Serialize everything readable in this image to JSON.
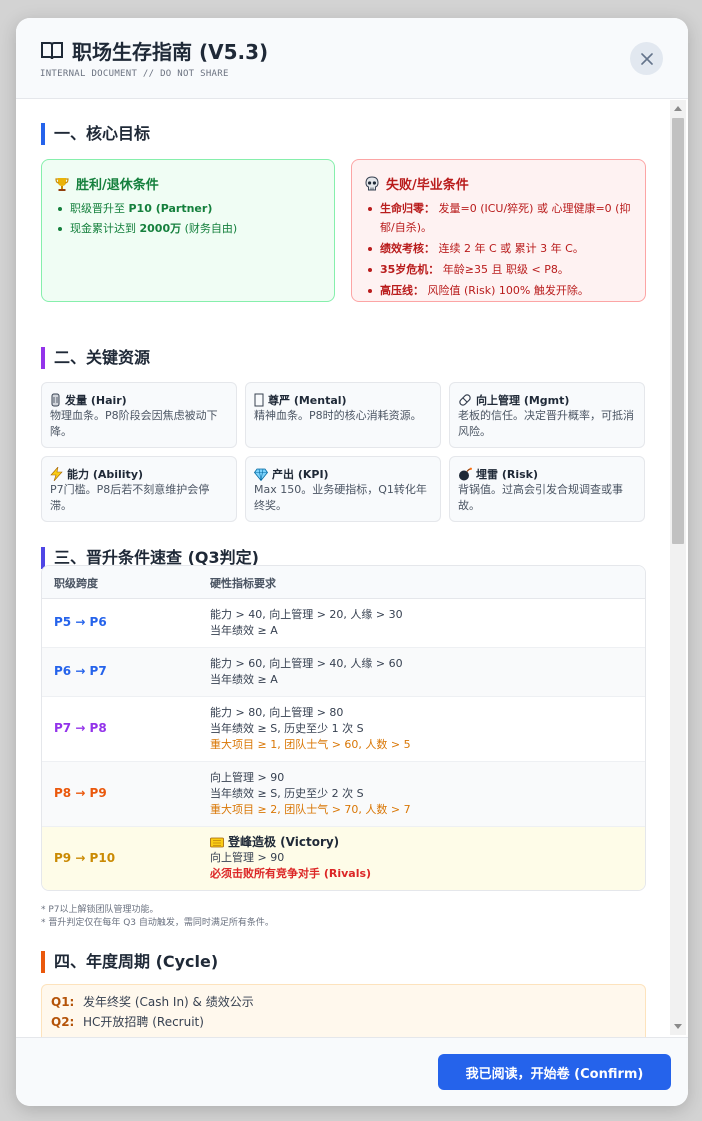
{
  "header": {
    "title": "职场生存指南 (V5.3)",
    "subtitle": "INTERNAL DOCUMENT // DO NOT SHARE",
    "close_icon": "close-icon"
  },
  "sections": {
    "goals": {
      "title": "一、核心目标",
      "accent": "#2563eb",
      "win": {
        "title": "胜利/退休条件",
        "icon": "trophy-icon",
        "items": [
          {
            "prefix": "职级晋升至 ",
            "bold": "P10 (Partner)",
            "suffix": ""
          },
          {
            "prefix": "现金累计达到 ",
            "bold": "2000万",
            "suffix": " (财务自由)"
          }
        ]
      },
      "lose": {
        "title": "失败/毕业条件",
        "icon": "skull-icon",
        "items": [
          {
            "label": "生命归零：",
            "text": " 发量=0 (ICU/猝死) 或 心理健康=0 (抑郁/自杀)。"
          },
          {
            "label": "绩效考核：",
            "text": " 连续 2 年 C 或 累计 3 年 C。"
          },
          {
            "label": "35岁危机：",
            "text": " 年龄≥35 且 职级 < P8。"
          },
          {
            "label": "高压线：",
            "text": " 风险值 (Risk) 100% 触发开除。"
          }
        ]
      }
    },
    "resources": {
      "title": "二、关键资源",
      "accent": "#9333ea",
      "items": [
        {
          "name": "发量 (Hair)",
          "icon": "hair-icon",
          "desc": "物理血条。P8阶段会因焦虑被动下降。"
        },
        {
          "name": "尊严 (Mental)",
          "icon": "mental-icon",
          "desc": "精神血条。P8时的核心消耗资源。"
        },
        {
          "name": "向上管理 (Mgmt)",
          "icon": "pill-icon",
          "desc": "老板的信任。决定晋升概率，可抵消风险。"
        },
        {
          "name": "能力 (Ability)",
          "icon": "lightning-icon",
          "desc": "P7门槛。P8后若不刻意维护会停滞。"
        },
        {
          "name": "产出 (KPI)",
          "icon": "diamond-icon",
          "desc": "Max 150。业务硬指标，Q1转化年终奖。"
        },
        {
          "name": "埋雷 (Risk)",
          "icon": "bomb-icon",
          "desc": "背锅值。过高会引发合规调查或事故。"
        }
      ]
    },
    "promotion": {
      "title": "三、晋升条件速查 (Q3判定)",
      "accent": "#4f46e5",
      "headers": [
        "职级跨度",
        "硬性指标要求"
      ],
      "rows": [
        {
          "level": "P5 → P6",
          "color": "#2563eb",
          "lines": [
            "能力 > 40, 向上管理 > 20, 人缘 > 30",
            "当年绩效 ≥ A"
          ],
          "gold": "",
          "victory": "",
          "red": ""
        },
        {
          "level": "P6 → P7",
          "color": "#2563eb",
          "lines": [
            "能力 > 60, 向上管理 > 40, 人缘 > 60",
            "当年绩效 ≥ A"
          ],
          "gold": "",
          "victory": "",
          "red": ""
        },
        {
          "level": "P7 → P8",
          "color": "#9333ea",
          "lines": [
            "能力 > 80, 向上管理 > 80",
            "当年绩效 ≥ S, 历史至少 1 次 S"
          ],
          "gold": "重大项目 ≥ 1, 团队士气 > 60, 人数 > 5",
          "victory": "",
          "red": ""
        },
        {
          "level": "P8 → P9",
          "color": "#ea580c",
          "lines": [
            "向上管理 > 90",
            "当年绩效 ≥ S, 历史至少 2 次 S"
          ],
          "gold": "重大项目 ≥ 2, 团队士气 > 70, 人数 > 7",
          "victory": "",
          "red": ""
        },
        {
          "level": "P9 → P10",
          "color": "#ca8a04",
          "lines": [
            "向上管理 > 90"
          ],
          "gold": "",
          "victory": "登峰造极 (Victory)",
          "red": "必须击败所有竞争对手 (Rivals)"
        }
      ],
      "notes": [
        "* P7以上解锁团队管理功能。",
        "* 晋升判定仅在每年 Q3 自动触发，需同时满足所有条件。"
      ]
    },
    "cycle": {
      "title": "四、年度周期 (Cycle)",
      "accent": "#ea580c",
      "rows": [
        {
          "q": "Q1:",
          "text": "发年终奖 (Cash In) & 绩效公示"
        },
        {
          "q": "Q2:",
          "text": "HC开放招聘 (Recruit)"
        }
      ]
    }
  },
  "footer": {
    "confirm_label": "我已阅读，开始卷 (Confirm)"
  }
}
